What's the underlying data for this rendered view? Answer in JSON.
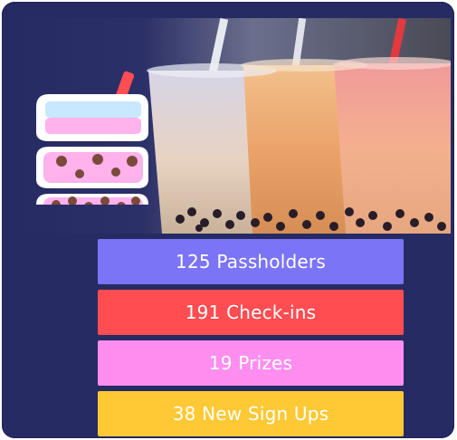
{
  "colors": {
    "background": "#272b63",
    "passholders": "#7b74f7",
    "checkins": "#ff4d52",
    "prizes": "#ff8ef0",
    "signups": "#ffc935"
  },
  "icons": {
    "boba_icon": "bubble-tea-layers-icon",
    "photo": "bubble-tea-cups-photo"
  },
  "stats": [
    {
      "label": "125 Passholders"
    },
    {
      "label": "191 Check-ins"
    },
    {
      "label": "19 Prizes"
    },
    {
      "label": "38 New Sign Ups"
    }
  ]
}
